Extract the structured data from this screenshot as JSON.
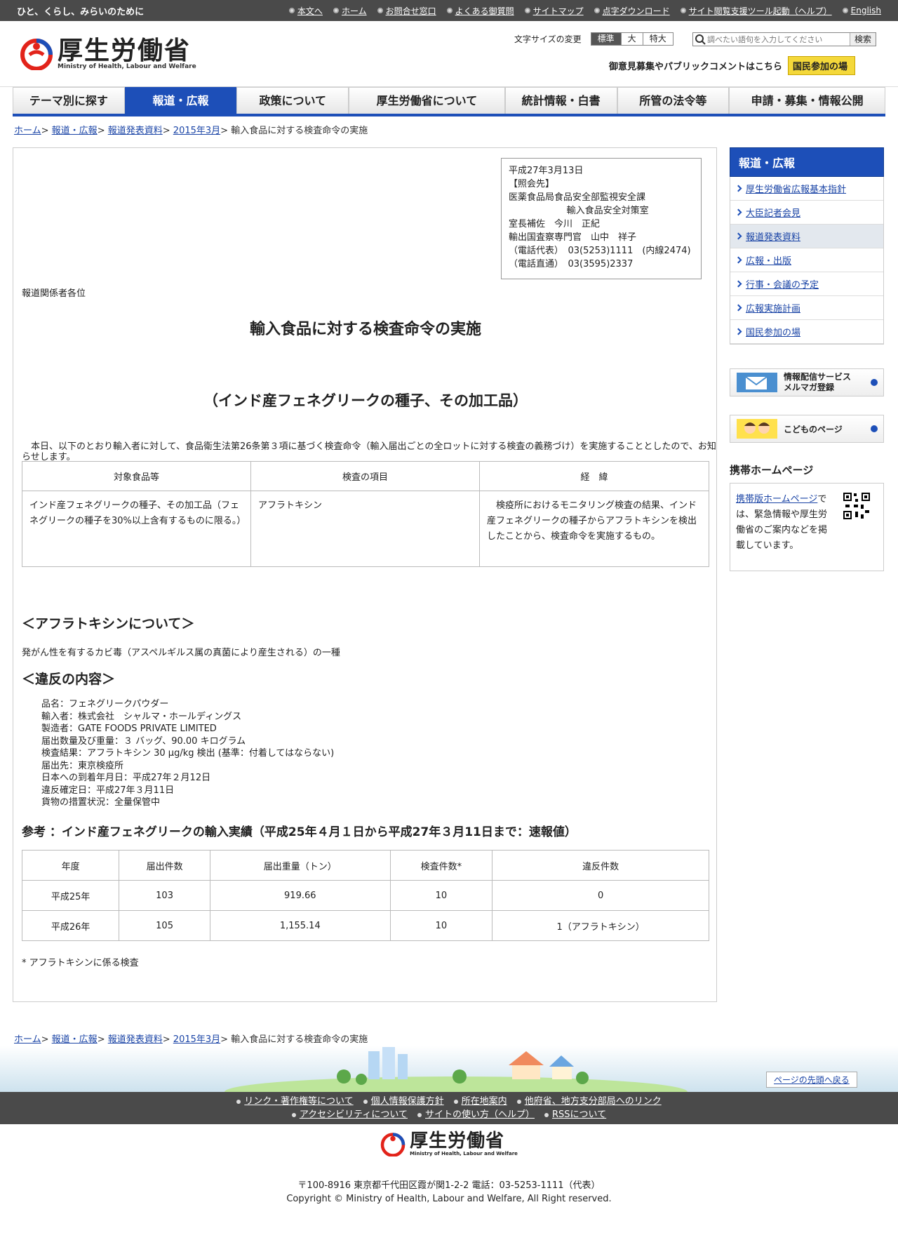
{
  "topbar": {
    "tagline": "ひと、くらし、みらいのために",
    "links": [
      "本文へ",
      "ホーム",
      "お問合せ窓口",
      "よくある御質問",
      "サイトマップ",
      "点字ダウンロード",
      "サイト閲覧支援ツール起動（ヘルプ）",
      "English"
    ]
  },
  "header": {
    "logo_jp": "厚生労働省",
    "logo_en": "Ministry of Health, Labour and Welfare",
    "font_size_label": "文字サイズの変更",
    "font_sizes": [
      "標準",
      "大",
      "特大"
    ],
    "search_placeholder": "調べたい語句を入力してください",
    "search_button": "検索",
    "public_comment_text": "御意見募集やパブリックコメントはこちら",
    "public_button": "国民参加の場"
  },
  "nav": [
    "テーマ別に探す",
    "報道・広報",
    "政策について",
    "厚生労働省について",
    "統計情報・白書",
    "所管の法令等",
    "申請・募集・情報公開"
  ],
  "breadcrumb": {
    "links": [
      "ホーム",
      "報道・広報",
      "報道発表資料",
      "2015年3月"
    ],
    "sep": ">",
    "current": "輸入食品に対する検査命令の実施"
  },
  "infobox": [
    "平成27年3月13日",
    "【照会先】",
    "医薬食品局食品安全部監視安全課",
    "                    輸入食品安全対策室",
    "室長補佐　今川　正紀",
    "輸出国査察専門官　山中　祥子",
    "（電話代表）　03(5253)1111　(内線2474)",
    "（電話直通）　03(3595)2337"
  ],
  "article": {
    "addressee": "報道関係者各位",
    "title": "輸入食品に対する検査命令の実施",
    "subtitle": "（インド産フェネグリークの種子、その加工品）",
    "intro": "　本日、以下のとおり輸入者に対して、食品衛生法第26条第３項に基づく検査命令（輸入届出ごとの全ロットに対する検査の義務づけ）を実施することとしたので、お知らせします。",
    "table1": {
      "headers": [
        "対象食品等",
        "検査の項目",
        "経　緯"
      ],
      "row": [
        "インド産フェネグリークの種子、その加工品（フェネグリークの種子を30%以上含有するものに限る。）",
        "アフラトキシン",
        "　検疫所におけるモニタリング検査の結果、インド産フェネグリークの種子からアフラトキシンを検出したことから、検査命令を実施するもの。"
      ]
    },
    "aflatoxin_heading": "＜アフラトキシンについて＞",
    "aflatoxin_text": "発がん性を有するカビ毒（アスペルギルス属の真菌により産生される）の一種",
    "violation_heading": "＜違反の内容＞",
    "violation_lines": [
      "品名：フェネグリークパウダー",
      "輸入者：株式会社　シャルマ・ホールディングス",
      "製造者：GATE FOODS PRIVATE LIMITED",
      "届出数量及び重量：３ バッグ、90.00 キログラム",
      "検査結果：アフラトキシン 30 μg/kg 検出 (基準：付着してはならない)",
      "届出先：東京検疫所",
      "日本への到着年月日：平成27年２月12日",
      "違反確定日：平成27年３月11日",
      "貨物の措置状況：全量保管中"
    ],
    "ref_heading": "参考 ：インド産フェネグリークの輸入実績（平成25年４月１日から平成27年３月11日まで：速報値）",
    "table2": {
      "headers": [
        "年度",
        "届出件数",
        "届出重量（トン）",
        "検査件数*",
        "違反件数"
      ],
      "rows": [
        [
          "平成25年",
          "103",
          "919.66",
          "10",
          "0"
        ],
        [
          "平成26年",
          "105",
          "1,155.14",
          "10",
          "1（アフラトキシン）"
        ]
      ]
    },
    "footnote": "* アフラトキシンに係る検査"
  },
  "sidebar": {
    "heading": "報道・広報",
    "items": [
      "厚生労働省広報基本指針",
      "大臣記者会見",
      "報道発表資料",
      "広報・出版",
      "行事・会議の予定",
      "広報実施計画",
      "国民参加の場"
    ],
    "banner1_line1": "情報配信サービス",
    "banner1_line2": "メルマガ登録",
    "banner2": "こどものページ",
    "mobile_heading": "携帯ホームページ",
    "mobile_link": "携帯版ホームページ",
    "mobile_text": "では、緊急情報や厚生労働省のご案内などを掲載しています。"
  },
  "footer": {
    "to_top": "ページの先頭へ戻る",
    "links_row1": [
      "リンク・著作権等について",
      "個人情報保護方針",
      "所在地案内",
      "他府省、地方支分部局へのリンク"
    ],
    "links_row2": [
      "アクセシビリティについて",
      "サイトの使い方（ヘルプ）",
      "RSSについて"
    ],
    "logo_jp": "厚生労働省",
    "logo_en": "Ministry of Health, Labour and Welfare",
    "address": "〒100-8916 東京都千代田区霞が関1-2-2 電話：03-5253-1111（代表）",
    "copyright": "Copyright © Ministry of Health, Labour and Welfare, All Right reserved."
  }
}
